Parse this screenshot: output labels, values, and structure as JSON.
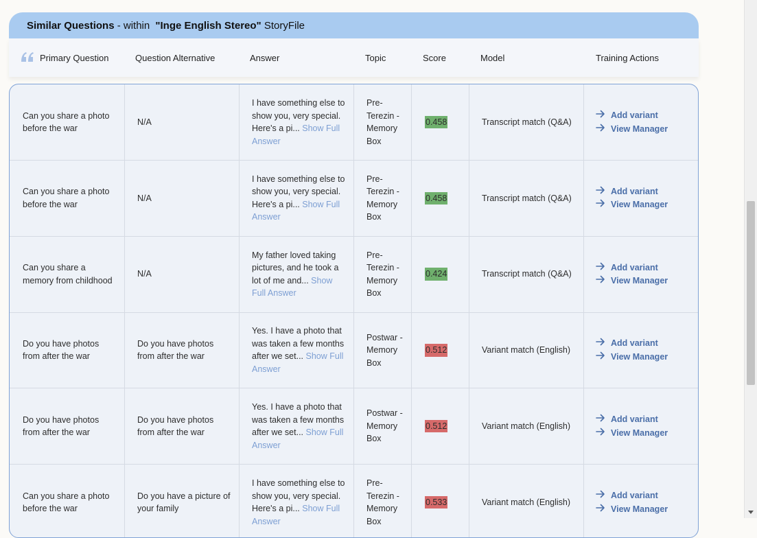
{
  "title": {
    "prefix": "Similar Questions",
    "within": " - within ",
    "name": "\"Inge English Stereo\"",
    "suffix": " StoryFile"
  },
  "columns": {
    "primary": "Primary Question",
    "alternative": "Question Alternative",
    "answer": "Answer",
    "topic": "Topic",
    "score": "Score",
    "model": "Model",
    "actions": "Training Actions"
  },
  "rows": [
    {
      "primary": "Can you share a photo before the war",
      "alternative": "N/A",
      "answer": "I have something else to show you, very special. Here's a pi...",
      "show": "Show Full Answer",
      "topic": "Pre-Terezin - Memory Box",
      "score": "0.458",
      "score_status": "good",
      "model": "Transcript match (Q&A)",
      "add": "Add variant",
      "view": "View Manager"
    },
    {
      "primary": "Can you share a photo before the war",
      "alternative": "N/A",
      "answer": "I have something else to show you, very special. Here's a pi...",
      "show": "Show Full Answer",
      "topic": "Pre-Terezin - Memory Box",
      "score": "0.458",
      "score_status": "good",
      "model": "Transcript match (Q&A)",
      "add": "Add variant",
      "view": "View Manager"
    },
    {
      "primary": "Can you share a memory from childhood",
      "alternative": "N/A",
      "answer": "My father loved taking pictures, and he took a lot of me and...",
      "show": "Show Full Answer",
      "topic": "Pre-Terezin - Memory Box",
      "score": "0.424",
      "score_status": "good",
      "model": "Transcript match (Q&A)",
      "add": "Add variant",
      "view": "View Manager"
    },
    {
      "primary": "Do you have photos from after the war",
      "alternative": "Do you have photos from after the war",
      "answer": "Yes. I have a photo that was taken a few months after we set...",
      "show": "Show Full Answer",
      "topic": "Postwar - Memory Box",
      "score": "0.512",
      "score_status": "bad",
      "model": "Variant match (English)",
      "add": "Add variant",
      "view": "View Manager"
    },
    {
      "primary": "Do you have photos from after the war",
      "alternative": "Do you have photos from after the war",
      "answer": "Yes. I have a photo that was taken a few months after we set...",
      "show": "Show Full Answer",
      "topic": "Postwar - Memory Box",
      "score": "0.512",
      "score_status": "bad",
      "model": "Variant match (English)",
      "add": "Add variant",
      "view": "View Manager"
    },
    {
      "primary": "Can you share a photo before the war",
      "alternative": "Do you have a picture of your family",
      "answer": "I have something else to show you, very special. Here's a pi...",
      "show": "Show Full Answer",
      "topic": "Pre-Terezin - Memory Box",
      "score": "0.533",
      "score_status": "bad",
      "model": "Variant match (English)",
      "add": "Add variant",
      "view": "View Manager"
    }
  ],
  "colors": {
    "header_bg": "#a9cbf0",
    "score_good": "#6fb06d",
    "score_bad": "#d66a6a",
    "link": "#4a6ea8",
    "show_link": "#7d9fd3"
  },
  "icons": {
    "quote": "quote-icon",
    "arrow": "arrow-right-icon"
  }
}
